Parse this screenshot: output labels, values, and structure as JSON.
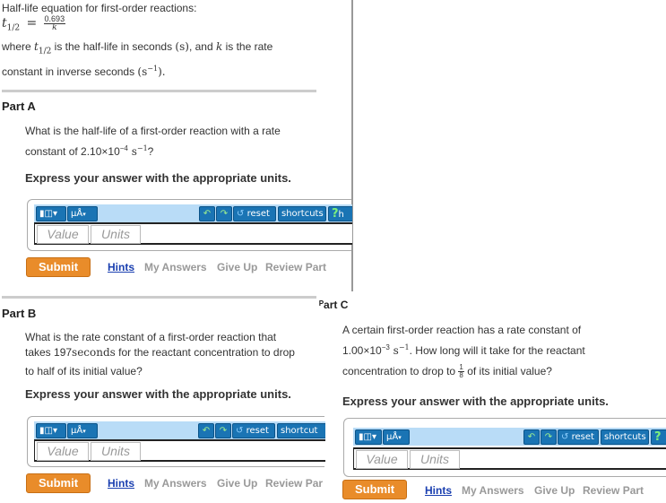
{
  "intro": {
    "heading": "Half-life equation for first-order reactions:",
    "equation": {
      "lhs": "t",
      "lhs_sub": "1/2",
      "numerator": "0.693",
      "denominator": "k"
    },
    "where_1": "where ",
    "where_t": "t",
    "where_t_sub": "1/2",
    "where_2": " is the half-life in seconds ",
    "where_unit": "(s)",
    "where_3": ", and ",
    "where_k": "k",
    "where_4": " is the rate",
    "line3_1": "constant in inverse seconds ",
    "line3_unit": "(s",
    "line3_sup": "−1",
    "line3_end": ").",
    "equals": "="
  },
  "parts": [
    {
      "title": "Part A",
      "question_line1": "What is the half-life of a first-order reaction with a rate",
      "question_line2_pre": "constant of 2.10×10",
      "question_exp": "−4",
      "question_unit": " s",
      "question_unit_sup": "−1",
      "question_end": "?",
      "instruction": "Express your answer with the appropriate units."
    },
    {
      "title": "Part B",
      "question_line1": "What is the rate constant of a first-order reaction that",
      "question_line2_pre": "takes 197",
      "question_line2_unit": "seconds",
      "question_line2_post": " for the reactant concentration to drop",
      "question_line3": "to half of its initial value?",
      "instruction": "Express your answer with the appropriate units."
    },
    {
      "title": "Part C",
      "title_visible": "ᴾart C",
      "question_line1": "A certain first-order reaction has a rate constant of",
      "question_line2_pre": "1.00×10",
      "question_exp": "−3",
      "question_unit": " s",
      "question_unit_sup": "−1",
      "question_line2_post": ". How long will it take for the reactant",
      "question_line3_pre": "concentration to drop to ",
      "fraction_num": "1",
      "fraction_den": "8",
      "question_line3_post": " of its initial value?",
      "instruction": "Express your answer with the appropriate units."
    }
  ],
  "answer_widget": {
    "template_icon": "templates-icon",
    "units_button": "μÅ",
    "undo_icon": "undo-icon",
    "redo_icon": "redo-icon",
    "reset_label": "reset",
    "shortcuts_label": "shortcuts",
    "help_label": "?",
    "help_label_partial": "h",
    "value_placeholder": "Value",
    "units_placeholder": "Units"
  },
  "actions": {
    "submit": "Submit",
    "hints": "Hints",
    "my_answers": "My Answers",
    "give_up": "Give Up",
    "review_part": "Review Part",
    "review_part_truncated": "Review Par",
    "shortcuts_truncated": "shortcut"
  },
  "colors": {
    "toolbar_bg": "#b9dcf7",
    "toolbar_button": "#1a74b4",
    "submit": "#e98c2a",
    "hints_link": "#1a3fb0",
    "disabled_link": "#999999"
  }
}
